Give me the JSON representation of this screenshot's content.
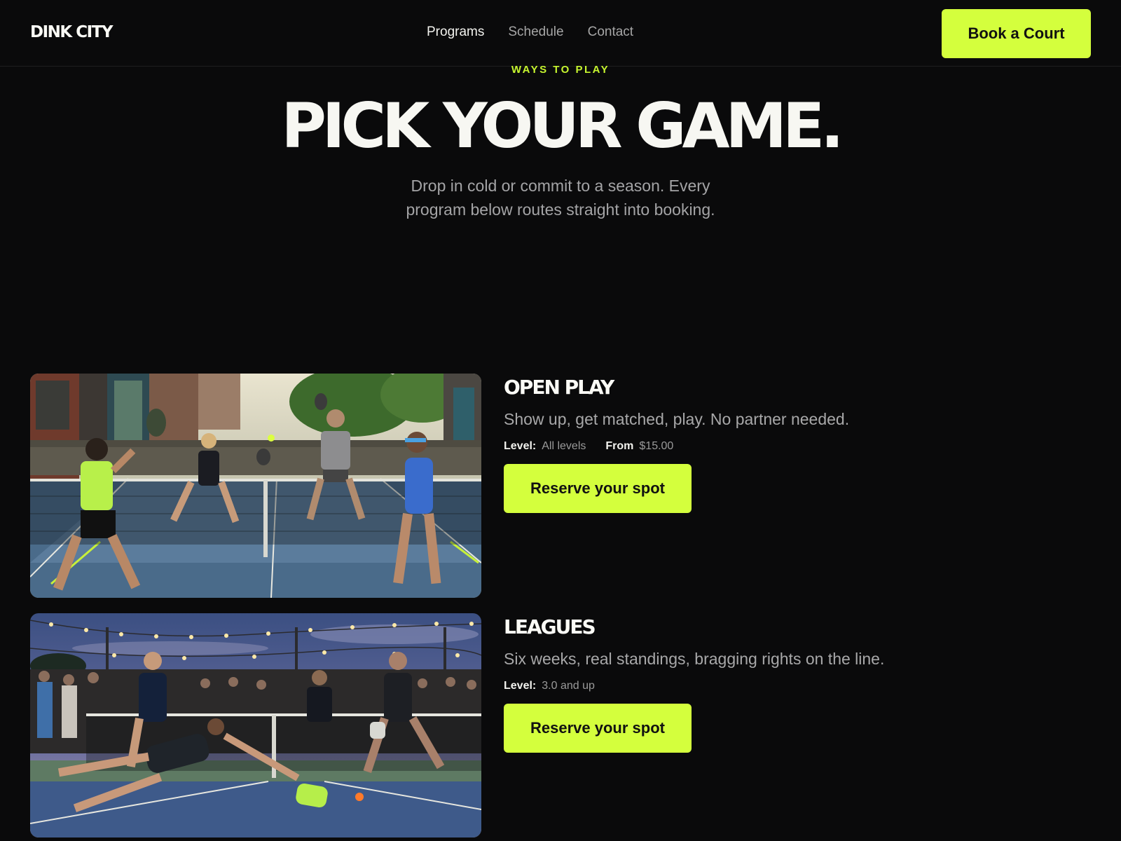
{
  "nav": {
    "logo": "DINK CITY",
    "links": [
      {
        "label": "Programs"
      },
      {
        "label": "Schedule"
      },
      {
        "label": "Contact"
      }
    ],
    "cta_label": "Book a Court"
  },
  "hero": {
    "eyebrow": "WAYS TO PLAY",
    "title": "PICK YOUR GAME.",
    "subtitle": "Drop in cold or commit to a season. Every program below routes straight into booking."
  },
  "programs": [
    {
      "title": "OPEN PLAY",
      "description": "Show up, get matched, play. No partner needed.",
      "level_label": "Level:",
      "level_value": "All levels",
      "price_label": "From",
      "price_value": "$15.00",
      "button_label": "Reserve your spot",
      "image_alt": "outdoor-doubles-photo"
    },
    {
      "title": "LEAGUES",
      "description": "Six weeks, real standings, bragging rights on the line.",
      "level_label": "Level:",
      "level_value": "3.0 and up",
      "button_label": "Reserve your spot",
      "image_alt": "night-league-photo"
    }
  ],
  "colors": {
    "background": "#0a0a0b",
    "accent": "#d4ff3d",
    "text_primary": "#f7f7f2",
    "text_muted": "#a6a6a6"
  }
}
